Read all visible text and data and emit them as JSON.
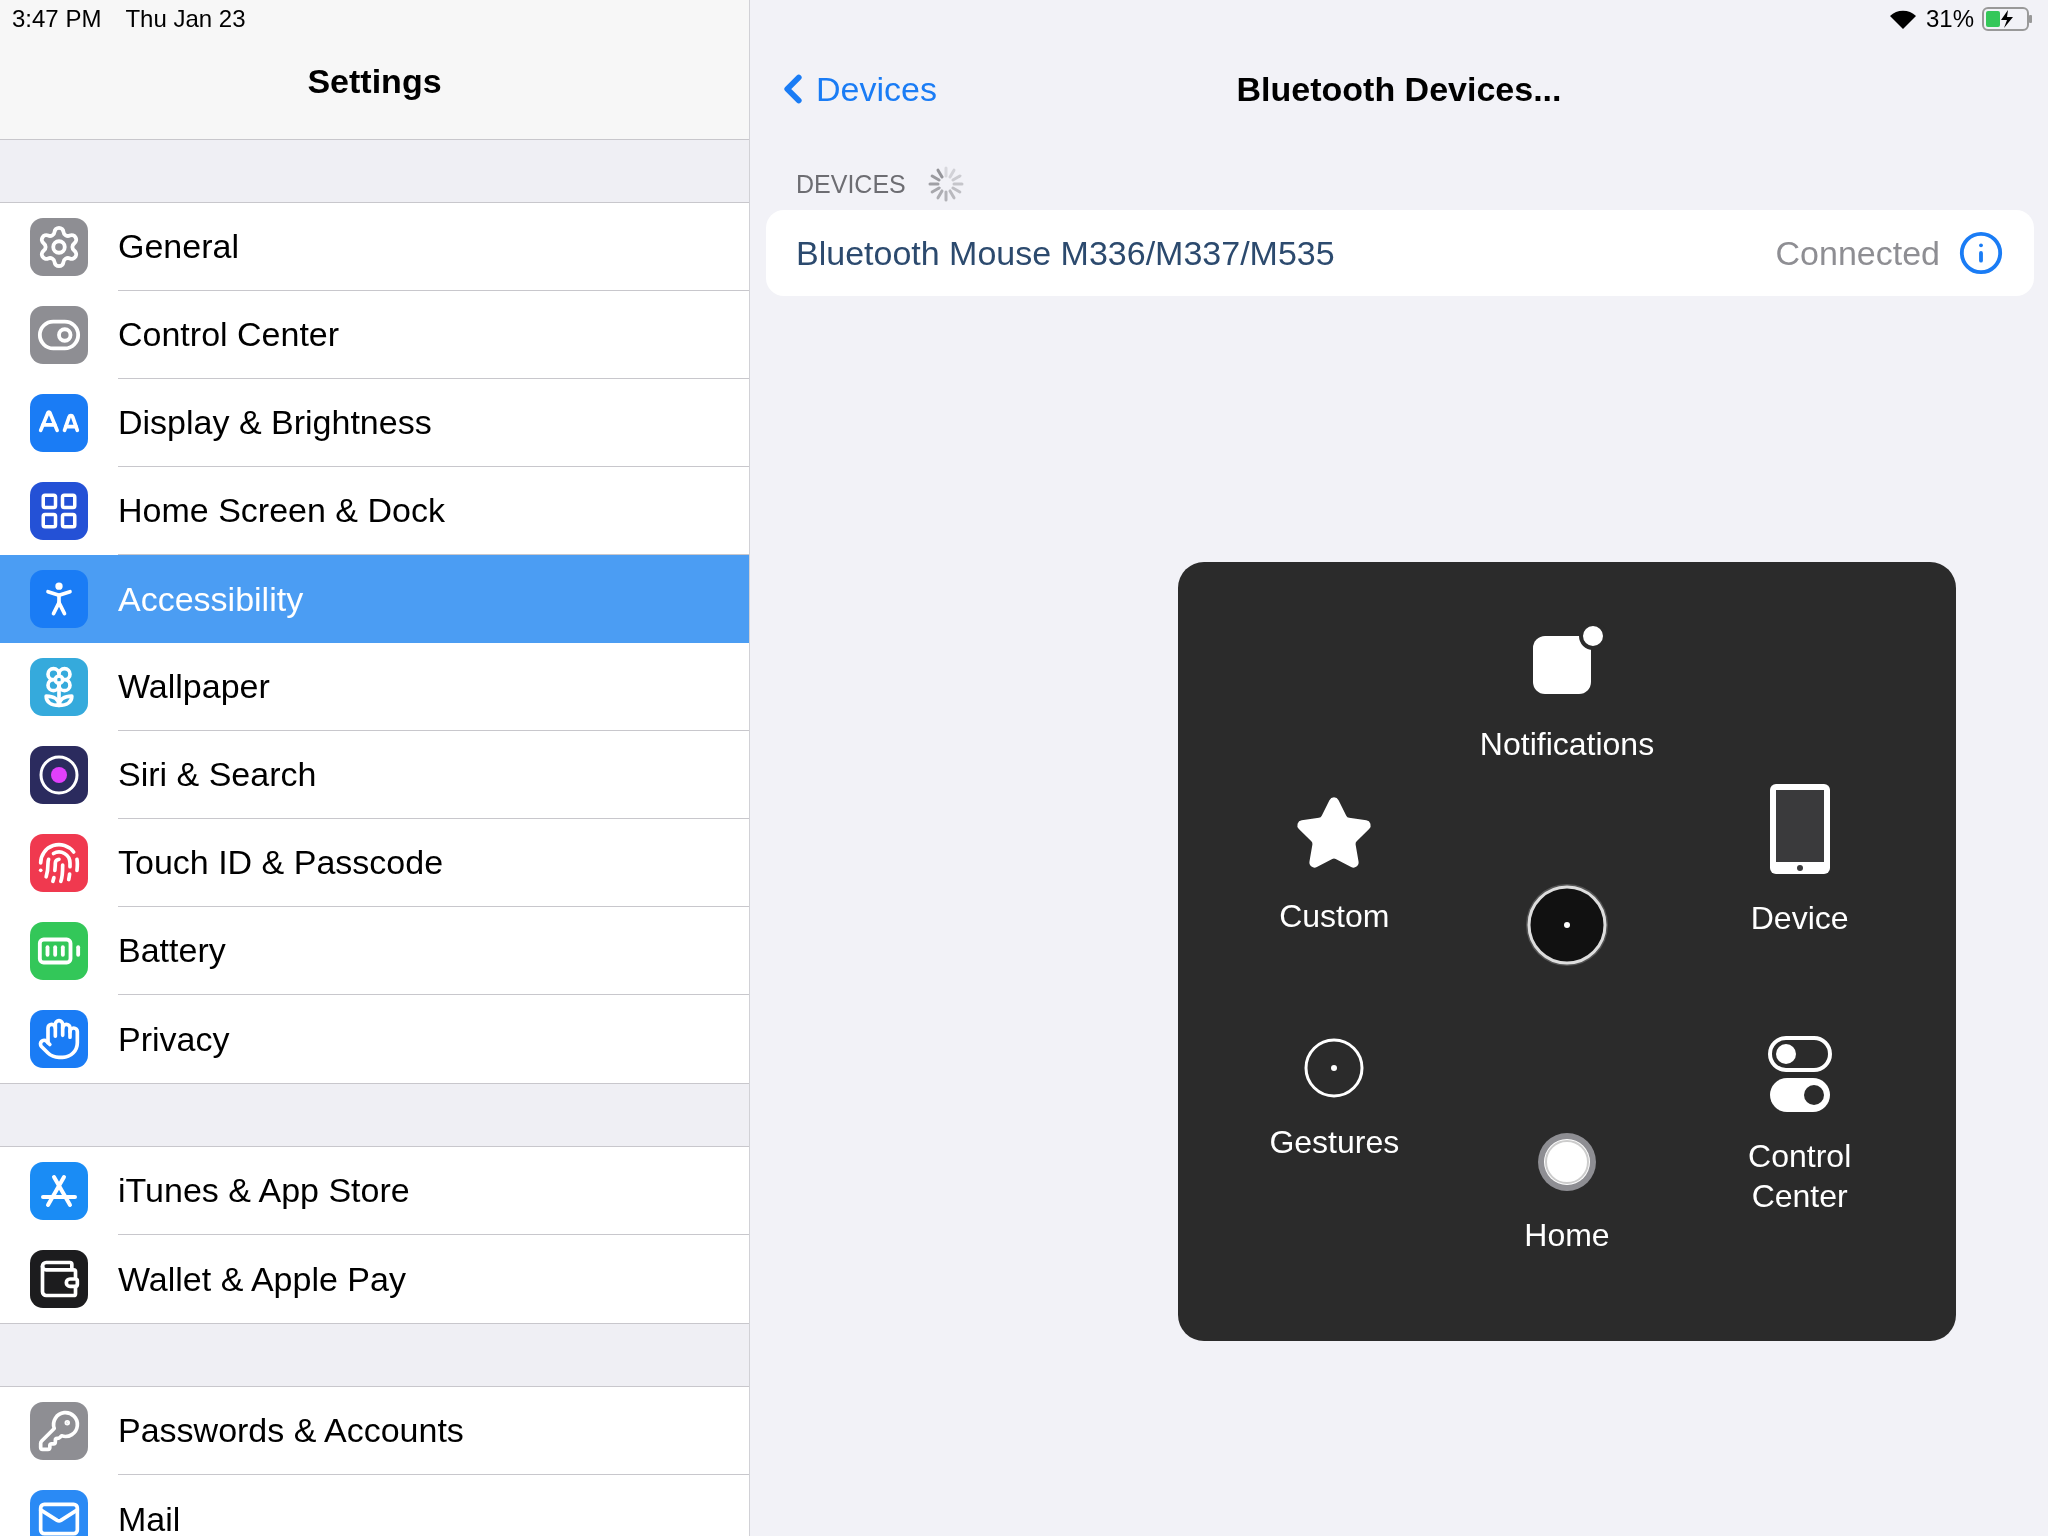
{
  "status_bar": {
    "time": "3:47 PM",
    "date": "Thu Jan 23",
    "battery_text": "31%",
    "charging": true
  },
  "sidebar": {
    "title": "Settings",
    "groups": [
      {
        "items": [
          {
            "label": "General",
            "color": "#8e8e93",
            "selected": false
          },
          {
            "label": "Control Center",
            "color": "#8e8e93",
            "selected": false
          },
          {
            "label": "Display & Brightness",
            "color": "#1a7cf5",
            "selected": false
          },
          {
            "label": "Home Screen & Dock",
            "color": "#2451d6",
            "selected": false
          },
          {
            "label": "Accessibility",
            "color": "#1a7cf5",
            "selected": true
          },
          {
            "label": "Wallpaper",
            "color": "#35aadc",
            "selected": false
          },
          {
            "label": "Siri & Search",
            "color": "#2b2b5e",
            "selected": false
          },
          {
            "label": "Touch ID & Passcode",
            "color": "#f0394f",
            "selected": false
          },
          {
            "label": "Battery",
            "color": "#33c759",
            "selected": false
          },
          {
            "label": "Privacy",
            "color": "#1a7cf5",
            "selected": false
          }
        ]
      },
      {
        "items": [
          {
            "label": "iTunes & App Store",
            "color": "#1a8cf5",
            "selected": false
          },
          {
            "label": "Wallet & Apple Pay",
            "color": "#1c1c1e",
            "selected": false
          }
        ]
      },
      {
        "items": [
          {
            "label": "Passwords & Accounts",
            "color": "#8e8e93",
            "selected": false
          },
          {
            "label": "Mail",
            "color": "#2a8af5",
            "selected": false
          }
        ]
      }
    ]
  },
  "detail": {
    "back_label": "Devices",
    "title": "Bluetooth Devices...",
    "section_header": "DEVICES",
    "devices": [
      {
        "name": "Bluetooth Mouse M336/M337/M535",
        "status": "Connected"
      }
    ]
  },
  "assistive_menu": {
    "items": [
      {
        "kind": "notifications",
        "label": "Notifications"
      },
      {
        "kind": "custom",
        "label": "Custom"
      },
      {
        "kind": "center"
      },
      {
        "kind": "device",
        "label": "Device"
      },
      {
        "kind": "gestures",
        "label": "Gestures"
      },
      {
        "kind": "home",
        "label": "Home"
      },
      {
        "kind": "control_center",
        "label": "Control Center"
      }
    ]
  }
}
